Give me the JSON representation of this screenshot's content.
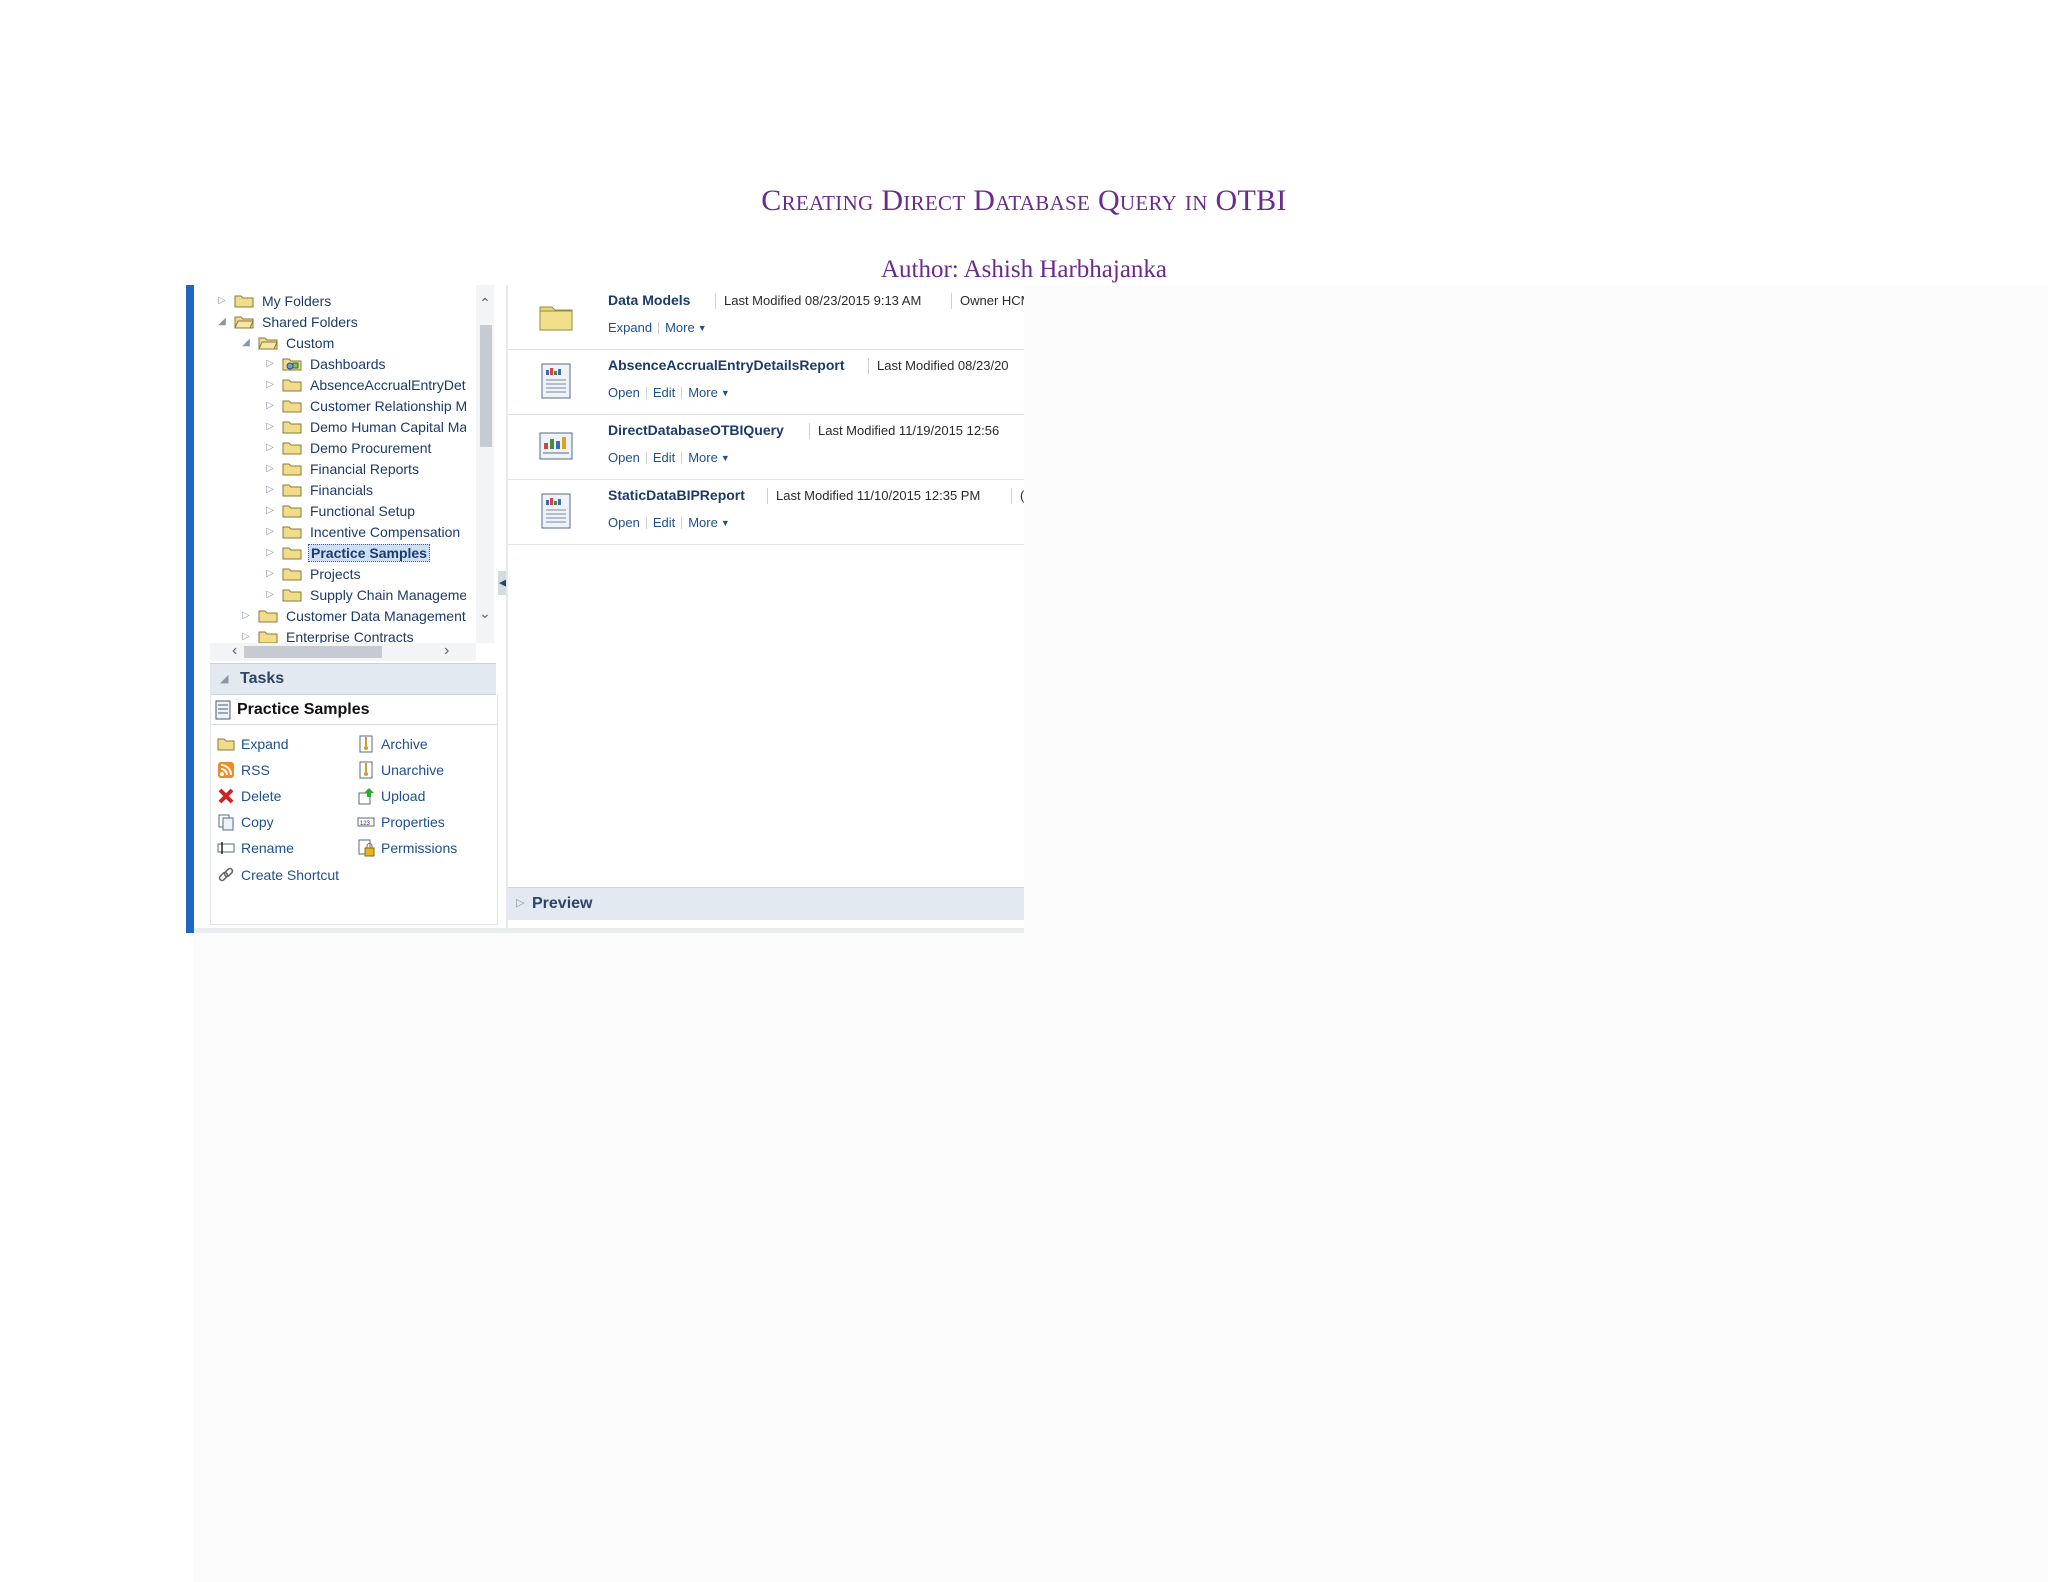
{
  "document": {
    "title": "Creating Direct Database Query in OTBI",
    "author": "Author: Ashish Harbhajanka"
  },
  "tree": [
    {
      "label": "My Folders",
      "level": 0,
      "expanded": false,
      "icon": "folder-icon"
    },
    {
      "label": "Shared Folders",
      "level": 0,
      "expanded": true,
      "icon": "folder-open-icon"
    },
    {
      "label": "Custom",
      "level": 1,
      "expanded": true,
      "icon": "folder-open-icon"
    },
    {
      "label": "Dashboards",
      "level": 2,
      "expanded": false,
      "icon": "dashboard-folder-icon"
    },
    {
      "label": "AbsenceAccrualEntryDetai",
      "level": 2,
      "expanded": false,
      "icon": "folder-icon"
    },
    {
      "label": "Customer Relationship Ma",
      "level": 2,
      "expanded": false,
      "icon": "folder-icon"
    },
    {
      "label": "Demo Human Capital Man",
      "level": 2,
      "expanded": false,
      "icon": "folder-icon"
    },
    {
      "label": "Demo Procurement",
      "level": 2,
      "expanded": false,
      "icon": "folder-icon"
    },
    {
      "label": "Financial Reports",
      "level": 2,
      "expanded": false,
      "icon": "folder-icon"
    },
    {
      "label": "Financials",
      "level": 2,
      "expanded": false,
      "icon": "folder-icon"
    },
    {
      "label": "Functional Setup",
      "level": 2,
      "expanded": false,
      "icon": "folder-icon"
    },
    {
      "label": "Incentive Compensation",
      "level": 2,
      "expanded": false,
      "icon": "folder-icon"
    },
    {
      "label": "Practice Samples",
      "level": 2,
      "expanded": false,
      "icon": "folder-icon",
      "selected": true
    },
    {
      "label": "Projects",
      "level": 2,
      "expanded": false,
      "icon": "folder-icon"
    },
    {
      "label": "Supply Chain Management",
      "level": 2,
      "expanded": false,
      "icon": "folder-icon"
    },
    {
      "label": "Customer Data Management",
      "level": 1,
      "expanded": false,
      "icon": "folder-icon"
    },
    {
      "label": "Enterprise Contracts",
      "level": 1,
      "expanded": false,
      "icon": "folder-icon"
    }
  ],
  "tasks": {
    "header": "Tasks",
    "folder_name": "Practice Samples",
    "left": [
      {
        "label": "Expand",
        "icon": "expand-folder-icon"
      },
      {
        "label": "RSS",
        "icon": "rss-icon"
      },
      {
        "label": "Delete",
        "icon": "delete-icon"
      },
      {
        "label": "Copy",
        "icon": "copy-icon"
      },
      {
        "label": "Rename",
        "icon": "rename-icon"
      },
      {
        "label": "Create Shortcut",
        "icon": "link-icon"
      }
    ],
    "right": [
      {
        "label": "Archive",
        "icon": "archive-icon"
      },
      {
        "label": "Unarchive",
        "icon": "unarchive-icon"
      },
      {
        "label": "Upload",
        "icon": "upload-icon"
      },
      {
        "label": "Properties",
        "icon": "properties-icon"
      },
      {
        "label": "Permissions",
        "icon": "permissions-icon"
      }
    ]
  },
  "items": [
    {
      "name": "Data Models",
      "meta": "Last Modified 08/23/2015 9:13 AM",
      "meta2": "Owner HCM",
      "actions": [
        "Expand",
        "More"
      ],
      "icon": "folder-icon"
    },
    {
      "name": "AbsenceAccrualEntryDetailsReport",
      "meta": "Last Modified 08/23/20",
      "meta2": "",
      "actions": [
        "Open",
        "Edit",
        "More"
      ],
      "icon": "report-icon"
    },
    {
      "name": "DirectDatabaseOTBIQuery",
      "meta": "Last Modified 11/19/2015 12:56",
      "meta2": "",
      "actions": [
        "Open",
        "Edit",
        "More"
      ],
      "icon": "analysis-icon"
    },
    {
      "name": "StaticDataBIPReport",
      "meta": "Last Modified 11/10/2015 12:35 PM",
      "meta2": "(",
      "actions": [
        "Open",
        "Edit",
        "More"
      ],
      "icon": "report-icon"
    }
  ],
  "preview": {
    "label": "Preview"
  }
}
